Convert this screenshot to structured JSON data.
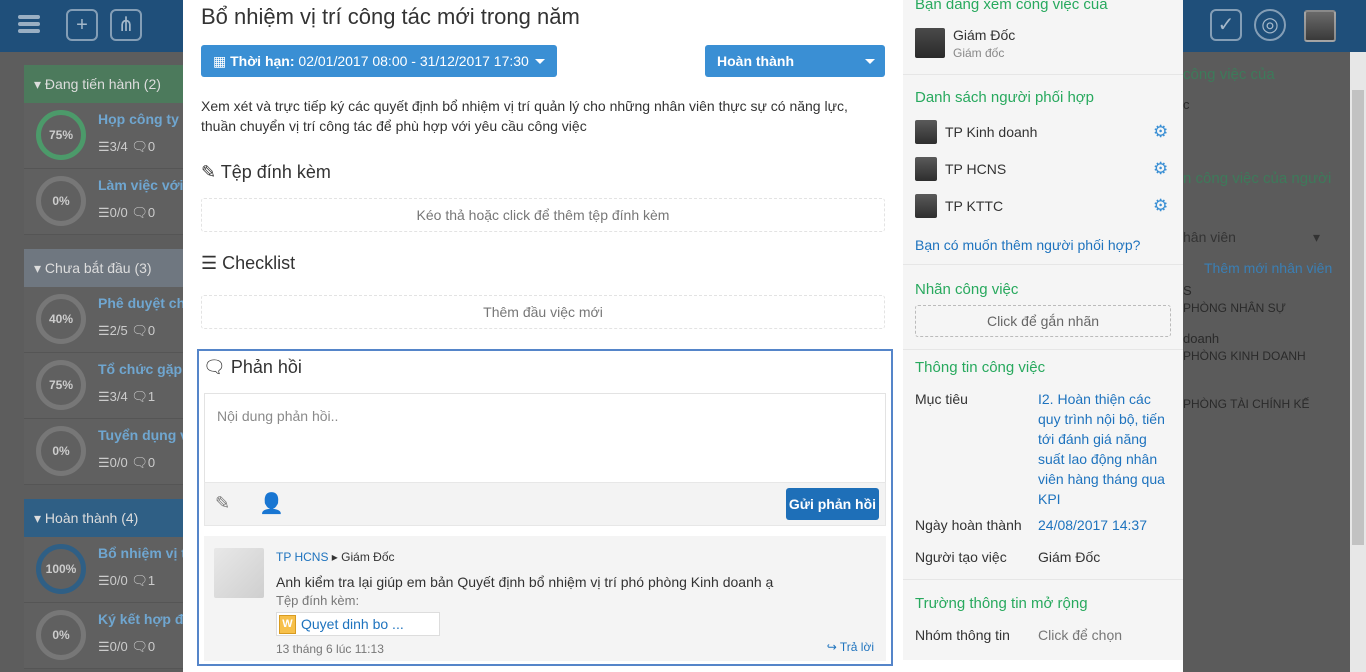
{
  "background": {
    "groups": [
      {
        "label": "Đang tiến hành",
        "count": "(2)"
      },
      {
        "label": "Chưa bắt đầu",
        "count": "(3)"
      },
      {
        "label": "Hoàn thành",
        "count": "(4)"
      }
    ],
    "tasks": [
      {
        "pct": "75%",
        "title": "Họp công ty",
        "meta": "☰3/4 🗨0"
      },
      {
        "pct": "0%",
        "title": "Làm việc với",
        "meta": "☰0/0 🗨0"
      },
      {
        "pct": "40%",
        "title": "Phê duyệt ch",
        "meta": "☰2/5 🗨0"
      },
      {
        "pct": "75%",
        "title": "Tổ chức gặp",
        "meta": "☰3/4 🗨1"
      },
      {
        "pct": "0%",
        "title": "Tuyển dụng v",
        "meta": "☰0/0 🗨0"
      },
      {
        "pct": "100%",
        "title": "Bổ nhiệm vị t",
        "meta": "☰0/0 🗨1"
      },
      {
        "pct": "0%",
        "title": "Ký kết hợp đ",
        "meta": "☰0/0 🗨0"
      }
    ],
    "right": {
      "t1": "công việc của",
      "s1": "c",
      "t2": "n công việc của người",
      "select_placeholder": "hân viên",
      "add_staff": "Thêm mới nhân viên",
      "r1a": "S",
      "r1b": "PHÒNG NHÂN SỰ",
      "r2a": "doanh",
      "r2b": "PHÒNG KINH DOANH",
      "r3a": "",
      "r3b": "PHÒNG TÀI CHÍNH KẾ"
    }
  },
  "task": {
    "title": "Bổ nhiệm vị trí công tác mới trong năm",
    "deadline_label": "Thời hạn:",
    "deadline_value": "02/01/2017 08:00 - 31/12/2017 17:30",
    "status": "Hoàn thành",
    "description": "Xem xét và trực tiếp ký các quyết định bổ nhiệm vị trí quản lý cho những nhân viên thực sự có năng lực, thuần chuyển vị trí công tác để phù hợp với yêu cầu công việc"
  },
  "attachments": {
    "heading": "Tệp đính kèm",
    "drop_hint": "Kéo thả hoặc click để thêm tệp đính kèm"
  },
  "checklist": {
    "heading": "Checklist",
    "add_hint": "Thêm đầu việc mới"
  },
  "feedback": {
    "heading": "Phản hồi",
    "placeholder": "Nội dung phản hồi..",
    "send_label": "Gửi phản hồi",
    "comment": {
      "author": "TP HCNS",
      "recipient": "Giám Đốc",
      "text": "Anh kiểm tra lại giúp em bản Quyết định bổ nhiệm vị trí phó phòng Kinh doanh ạ",
      "attach_label": "Tệp đính kèm:",
      "file_name": "Quyet dinh bo ...",
      "time": "13 tháng 6 lúc 11:13",
      "reply_label": "Trả lời"
    }
  },
  "panel": {
    "viewing_heading": "Bạn đang xem công việc của",
    "viewer_name": "Giám Đốc",
    "viewer_role": "Giám đốc",
    "collab_heading": "Danh sách người phối hợp",
    "collaborators": [
      "TP Kinh doanh",
      "TP HCNS",
      "TP KTTC"
    ],
    "add_collab": "Bạn có muốn thêm người phối hợp?",
    "tag_heading": "Nhãn công việc",
    "tag_hint": "Click để gắn nhãn",
    "info_heading": "Thông tin công việc",
    "goal_label": "Mục tiêu",
    "goal_value": "I2. Hoàn thiện các quy trình nội bộ, tiến tới đánh giá năng suất lao động nhân viên hàng tháng qua KPI",
    "done_label": "Ngày hoàn thành",
    "done_value": "24/08/2017 14:37",
    "creator_label": "Người tạo việc",
    "creator_value": "Giám Đốc",
    "ext_heading": "Trường thông tin mở rộng",
    "group_label": "Nhóm thông tin",
    "group_value": "Click để chọn"
  },
  "colors": {
    "accent": "#3a8fd4",
    "green": "#28a95e",
    "link": "#1e73be",
    "highlight": "#5585c9"
  }
}
